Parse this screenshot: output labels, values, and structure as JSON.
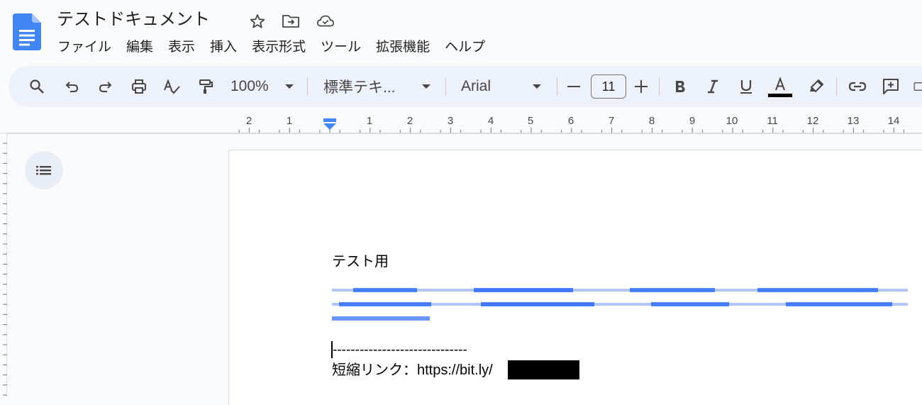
{
  "document": {
    "title": "テストドキュメント"
  },
  "menu": [
    {
      "label": "ファイル"
    },
    {
      "label": "編集"
    },
    {
      "label": "表示"
    },
    {
      "label": "挿入"
    },
    {
      "label": "表示形式"
    },
    {
      "label": "ツール"
    },
    {
      "label": "拡張機能"
    },
    {
      "label": "ヘルプ"
    }
  ],
  "toolbar": {
    "zoom": "100%",
    "style": "標準テキ...",
    "font": "Arial",
    "font_size": "11"
  },
  "ruler": {
    "labels": [
      "2",
      "1",
      "1",
      "2",
      "3",
      "4",
      "5",
      "6",
      "7",
      "8",
      "9",
      "10",
      "11",
      "12",
      "13",
      "14"
    ]
  },
  "content": {
    "line1": "テスト用",
    "line2": "------------------------------",
    "line3": "短縮リンク：https://bit.ly/"
  },
  "colors": {
    "accent": "#1a73e8",
    "toolbar_bg": "#edf2fa",
    "doc_blue": "#4285f4",
    "link_blue": "#1a5cff"
  }
}
